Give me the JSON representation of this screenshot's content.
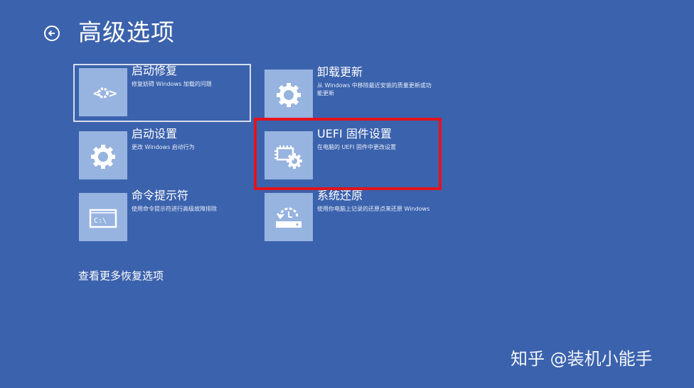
{
  "header": {
    "title": "高级选项",
    "back_icon": "back-arrow-icon"
  },
  "options": [
    {
      "label": "启动修复",
      "desc": "修复妨碍 Windows 加载的问题",
      "icon": "startup-repair-icon"
    },
    {
      "label": "卸载更新",
      "desc": "从 Windows 中移除最近安装的质量更新或功能更新",
      "icon": "gear-icon"
    },
    {
      "label": "启动设置",
      "desc": "更改 Windows 启动行为",
      "icon": "gear-icon"
    },
    {
      "label": "UEFI 固件设置",
      "desc": "在电脑的 UEFI 固件中更改设置",
      "icon": "firmware-chip-gear-icon"
    },
    {
      "label": "命令提示符",
      "desc": "使用命令提示符进行高级故障排除",
      "icon": "command-prompt-icon"
    },
    {
      "label": "系统还原",
      "desc": "使用你电脑上记录的还原点来还原 Windows",
      "icon": "system-restore-icon"
    }
  ],
  "footer": {
    "more_options": "查看更多恢复选项"
  },
  "watermark": "知乎 @装机小能手",
  "colors": {
    "background": "#3b62ad",
    "tile_icon_bg": "#97b3e0",
    "highlight_border": "#e3141b"
  }
}
